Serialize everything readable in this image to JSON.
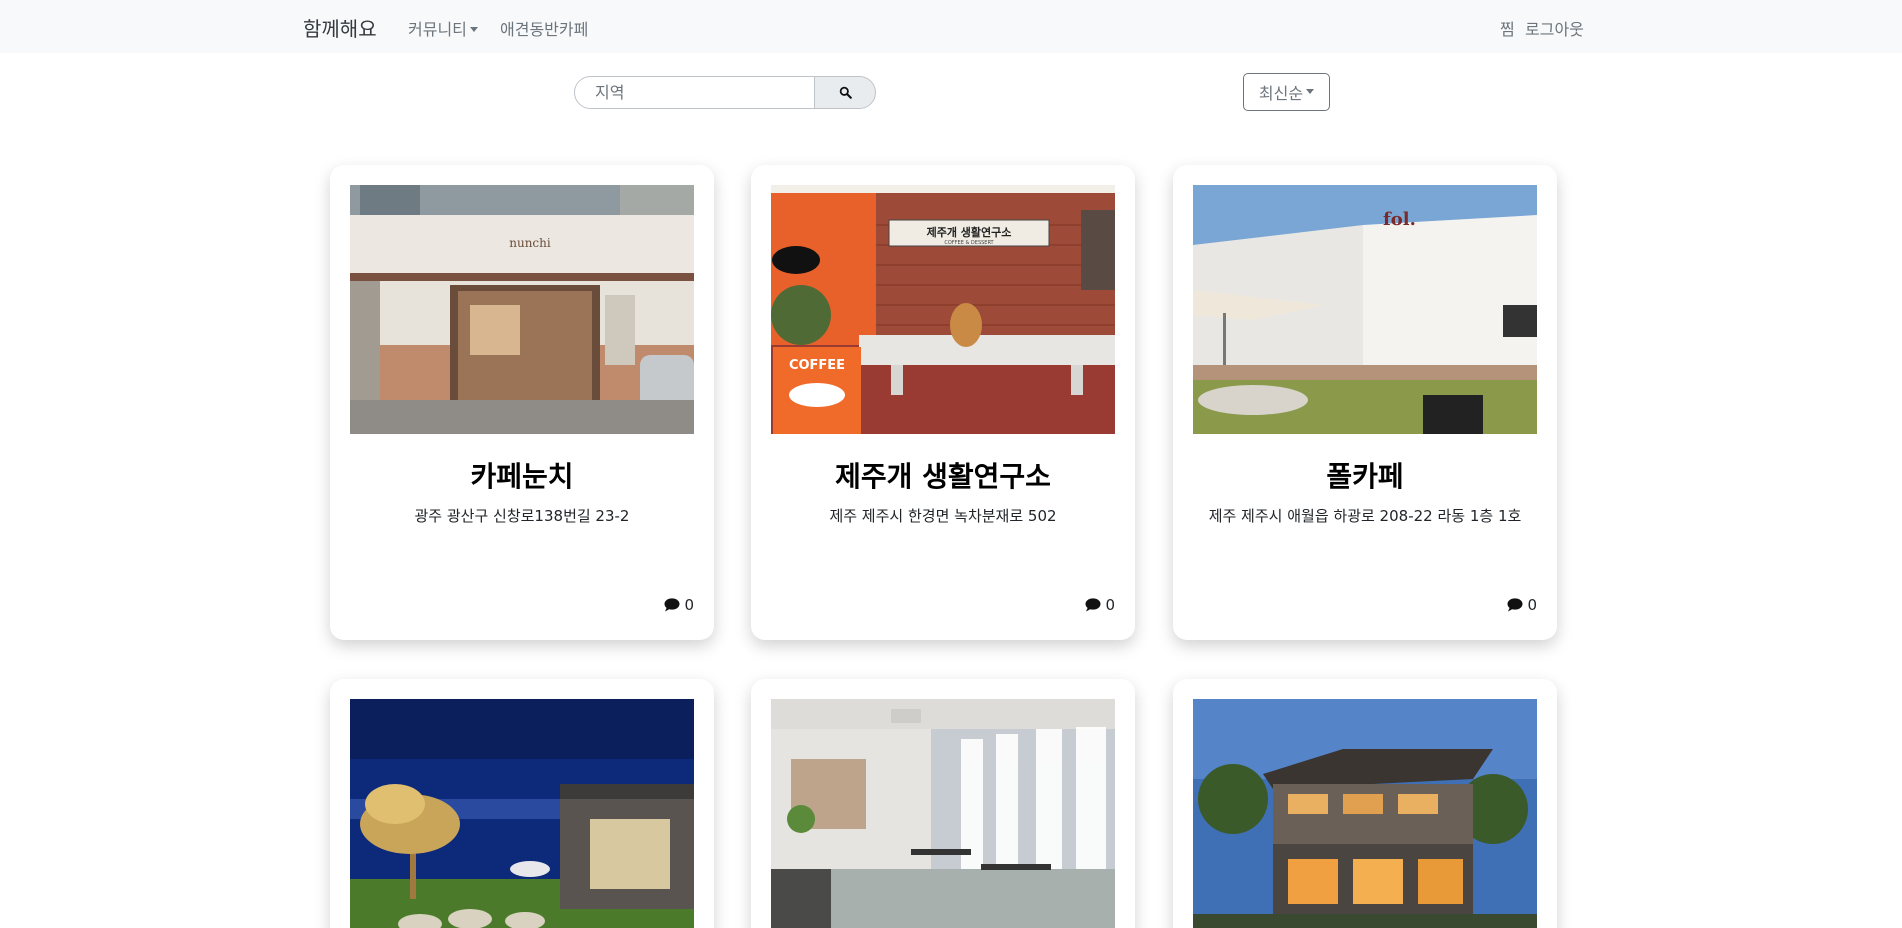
{
  "navbar": {
    "brand": "함께해요",
    "community": "커뮤니티",
    "petcafe": "애견동반카페",
    "like": "찜",
    "logout": "로그아웃"
  },
  "search": {
    "placeholder": "지역",
    "value": ""
  },
  "sort": {
    "label": "최신순"
  },
  "cafes": [
    {
      "name": "카페눈치",
      "address": "광주 광산구 신창로138번길 23-2",
      "comments": "0",
      "sign_text": "nunchi"
    },
    {
      "name": "제주개 생활연구소",
      "address": "제주 제주시 한경면 녹차분재로 502",
      "comments": "0",
      "sign_text": "제주개 생활연구소",
      "sign_sub": "COFFEE & DESSERT",
      "poster_text": "COFFEE"
    },
    {
      "name": "폴카페",
      "address": "제주 제주시 애월읍 하광로 208-22 라동 1층 1호",
      "comments": "0",
      "sign_text": "fol."
    },
    {
      "name": "",
      "address": "",
      "comments": ""
    },
    {
      "name": "",
      "address": "",
      "comments": ""
    },
    {
      "name": "",
      "address": "",
      "comments": ""
    }
  ],
  "colors": {
    "navbar_bg": "#f8f9fa",
    "nav_text": "#6c757d",
    "card_shadow": "rgba(0,0,0,0.18)"
  }
}
